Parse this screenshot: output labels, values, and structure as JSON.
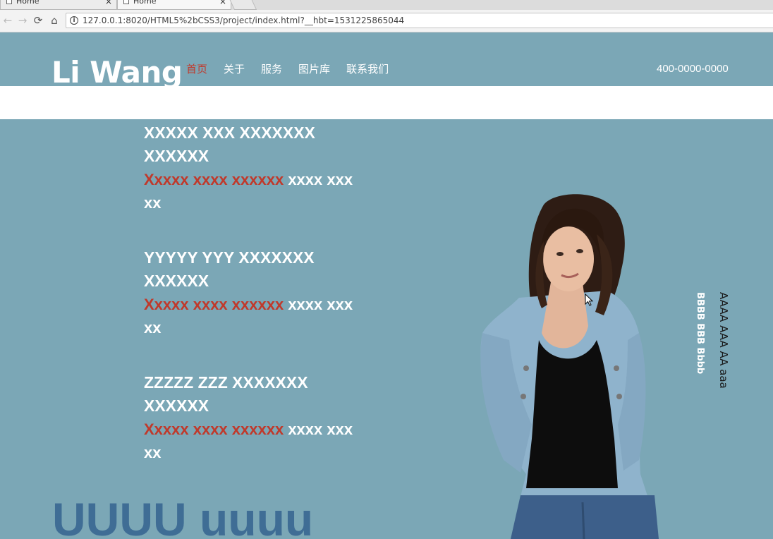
{
  "browser": {
    "tabs": [
      {
        "title": "Home",
        "close": "×"
      },
      {
        "title": "Home",
        "close": "×"
      }
    ],
    "nav": {
      "back": "←",
      "forward": "→",
      "reload": "⟳",
      "home": "⌂"
    },
    "url": "127.0.0.1:8020/HTML5%2bCSS3/project/index.html?__hbt=1531225865044"
  },
  "header": {
    "logo": "Li Wang",
    "menu": [
      "首页",
      "关于",
      "服务",
      "图片库",
      "联系我们"
    ],
    "active_index": 0,
    "phone": "400-0000-0000"
  },
  "content": {
    "items": [
      {
        "title": "XXXXX XXX XXXXXXX XXXXXX",
        "red": "Xxxxx xxxx xxxxxx",
        "white": " xxxx xxx xx"
      },
      {
        "title": "YYYYY YYY XXXXXXX XXXXXX",
        "red": "Xxxxx xxxx xxxxxx",
        "white": " xxxx xxx xx"
      },
      {
        "title": "ZZZZZ ZZZ XXXXXXX XXXXXX",
        "red": "Xxxxx xxxx xxxxxx",
        "white": " xxxx xxx xx"
      }
    ],
    "big_text": "UUUU uuuu"
  },
  "side": {
    "vertical_b": "BBBB BBB Bbbb",
    "vertical_a": "AAAA AAA AA aaa"
  },
  "colors": {
    "background": "#7ba7b6",
    "accent_red": "#c0392b",
    "big_text": "#3f6d95"
  }
}
